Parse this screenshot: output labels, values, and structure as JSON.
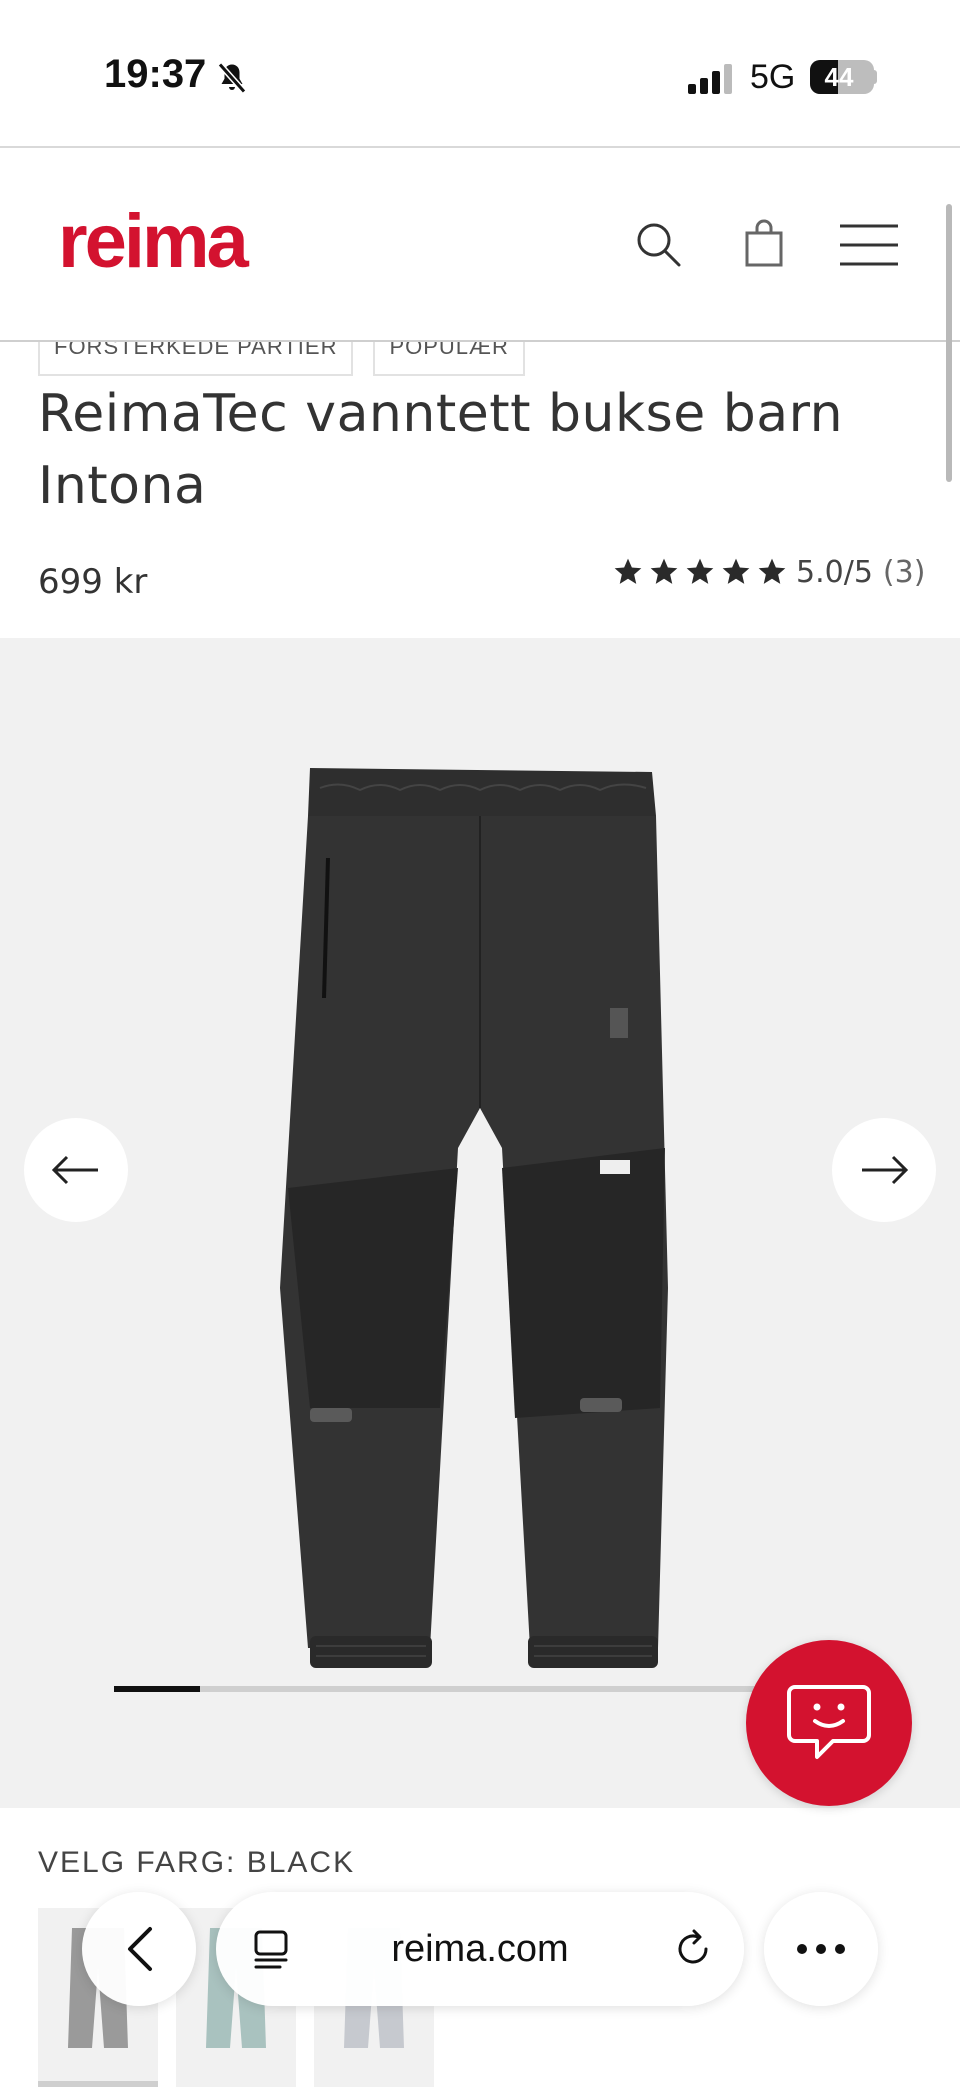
{
  "status_bar": {
    "time": "19:37",
    "network": "5G",
    "battery_percent": "44",
    "battery_level": 0.44,
    "icons": [
      "bell-slash-icon",
      "signal-icon",
      "battery-icon"
    ]
  },
  "header": {
    "logo_text": "reima",
    "brand_color": "#d3122f",
    "icons": [
      "search-icon",
      "shopping-bag-icon",
      "hamburger-menu-icon"
    ]
  },
  "product": {
    "tags": [
      "FORSTERKEDE PARTIER",
      "POPULÆR"
    ],
    "title": "ReimaTec vanntett bukse barn Intona",
    "price": "699 kr",
    "rating": {
      "stars": 5,
      "score_text": "5.0/5",
      "count_text": "(3)"
    }
  },
  "gallery": {
    "image_icon": "black-pants-image",
    "progress": 0.13,
    "icons": [
      "arrow-left-icon",
      "arrow-right-icon",
      "chat-smiley-icon"
    ]
  },
  "color_select": {
    "label": "VELG FARG: BLACK",
    "swatch_count": 3
  },
  "browser": {
    "url": "reima.com",
    "icons": [
      "chevron-left-icon",
      "tabs-icon",
      "reload-icon",
      "more-dots-icon"
    ]
  }
}
